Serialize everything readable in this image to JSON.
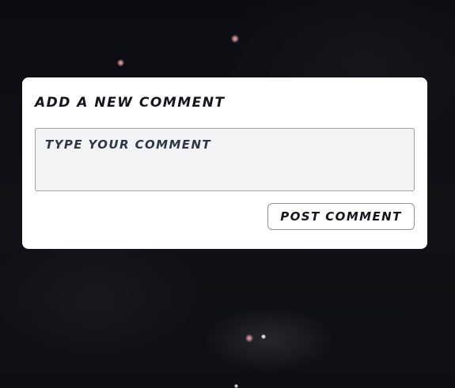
{
  "comment_form": {
    "title": "ADD A NEW COMMENT",
    "textarea": {
      "value": "",
      "placeholder": "TYPE YOUR COMMENT"
    },
    "post_button_label": "POST COMMENT"
  },
  "colors": {
    "background": "#0d0f14",
    "card": "#ffffff",
    "textarea_fill": "#f2f3f5",
    "text": "#15161a"
  }
}
